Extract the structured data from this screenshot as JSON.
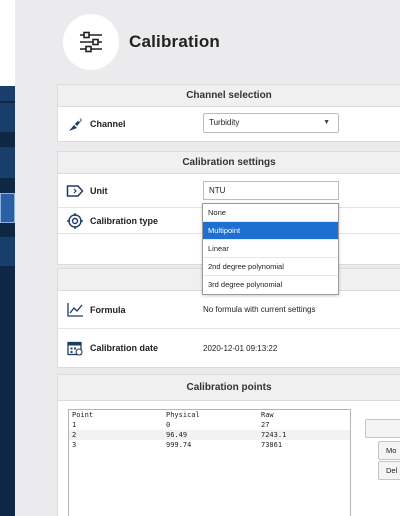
{
  "header": {
    "title": "Calibration",
    "icon": "sliders-icon"
  },
  "channel_selection": {
    "heading": "Channel selection",
    "channel": {
      "label": "Channel",
      "value": "Turbidity"
    }
  },
  "calibration_settings": {
    "heading": "Calibration settings",
    "unit": {
      "label": "Unit",
      "value": "NTU"
    },
    "calibration_type": {
      "label": "Calibration type",
      "options": [
        "None",
        "Multipoint",
        "Linear",
        "2nd degree polynomial",
        "3rd degree polynomial"
      ],
      "selected": "Multipoint"
    }
  },
  "formula_panel": {
    "formula": {
      "label": "Formula",
      "value": "No formula with current settings"
    },
    "date": {
      "label": "Calibration date",
      "value": "2020-12-01 09:13:22"
    }
  },
  "calibration_points": {
    "heading": "Calibration points",
    "columns": [
      "Point",
      "Physical",
      "Raw"
    ],
    "rows": [
      [
        "1",
        "0",
        "27"
      ],
      [
        "2",
        "96.49",
        "7243.1"
      ],
      [
        "3",
        "999.74",
        "73861"
      ]
    ],
    "buttons": [
      "",
      "Mo",
      "Del"
    ]
  }
}
